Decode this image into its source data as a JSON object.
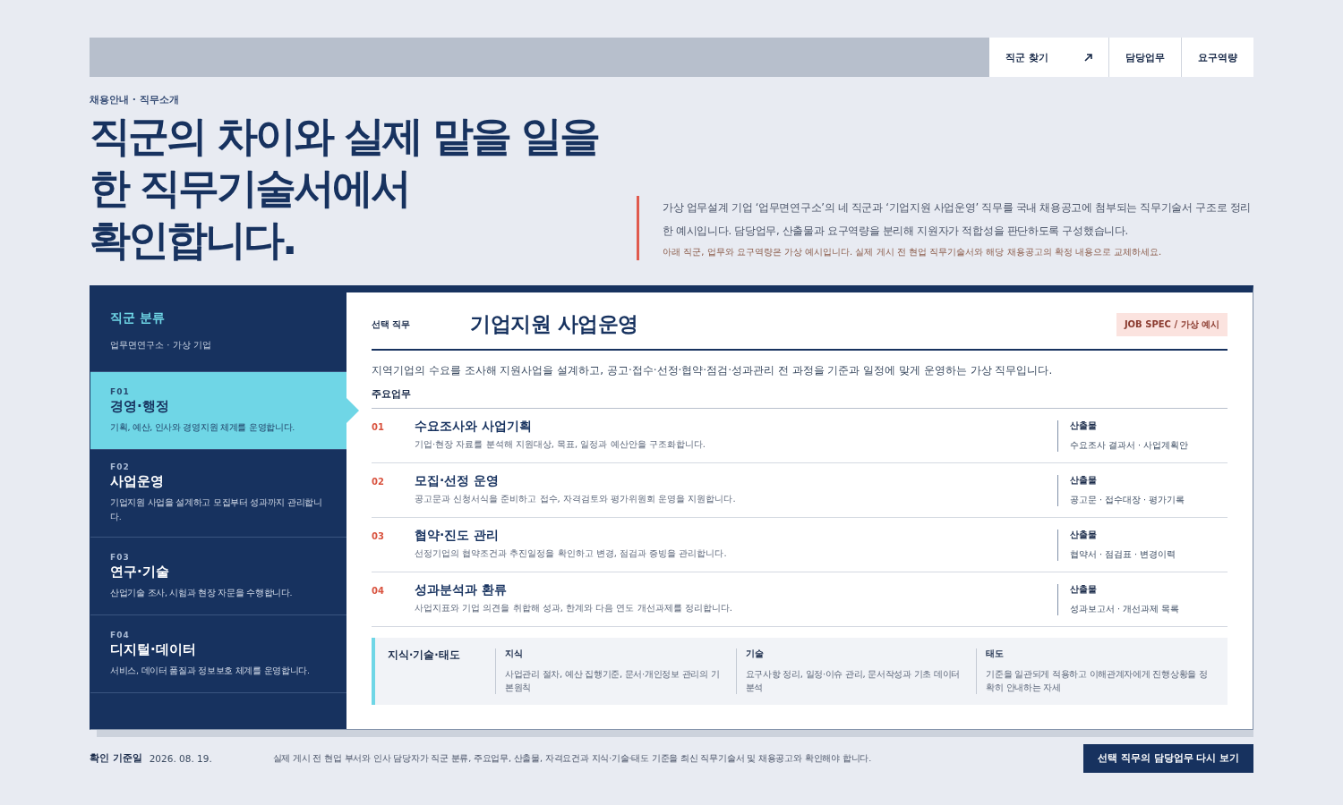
{
  "nav": [
    {
      "label": "직군 찾기",
      "kind": "external"
    },
    {
      "label": "담당업무",
      "kind": "plain"
    },
    {
      "label": "요구역량",
      "kind": "plain"
    }
  ],
  "breadcrumb": "채용안내 · 직무소개",
  "headline": [
    "직군의 차이와 실제 맡을 일을",
    "한 직무기술서에서",
    "확인합니다."
  ],
  "intro": {
    "text": "가상 업무설계 기업 ‘업무면연구소’의 네 직군과 ‘기업지원 사업운영’ 직무를 국내 채용공고에 첨부되는 직무기술서 구조로 정리한 예시입니다. 담당업무, 산출물과 요구역량을 분리해 지원자가 적합성을 판단하도록 구성했습니다.",
    "note": "아래 직군, 업무와 요구역량은 가상 예시입니다. 실제 게시 전 현업 직무기술서와 해당 채용공고의 확정 내용으로 교체하세요."
  },
  "sidebar": {
    "title": "직군 분류",
    "subtitle": "업무면연구소 · 가상 기업",
    "items": [
      {
        "code": "F01",
        "name": "경영·행정",
        "desc": "기획, 예산, 인사와 경영지원 체계를 운영합니다.",
        "selected": true
      },
      {
        "code": "F02",
        "name": "사업운영",
        "desc": "기업지원 사업을 설계하고 모집부터 성과까지 관리합니다.",
        "selected": false
      },
      {
        "code": "F03",
        "name": "연구·기술",
        "desc": "산업기술 조사, 시험과 현장 자문을 수행합니다.",
        "selected": false
      },
      {
        "code": "F04",
        "name": "디지털·데이터",
        "desc": "서비스, 데이터 품질과 정보보호 체계를 운영합니다.",
        "selected": false
      }
    ]
  },
  "job": {
    "label": "선택 직무",
    "title": "기업지원 사업운영",
    "badge": "JOB SPEC / 가상 예시",
    "summary": "지역기업의 수요를 조사해 지원사업을 설계하고, 공고·접수·선정·협약·점검·성과관리 전 과정을 기준과 일정에 맞게 운영하는 가상 직무입니다.",
    "duties_heading": "주요업무",
    "duties": [
      {
        "no": "01",
        "title": "수요조사와 사업기획",
        "desc": "기업·현장 자료를 분석해 지원대상, 목표, 일정과 예산안을 구조화합니다.",
        "output_label": "산출물",
        "output": "수요조사 결과서 · 사업계획안"
      },
      {
        "no": "02",
        "title": "모집·선정 운영",
        "desc": "공고문과 신청서식을 준비하고 접수, 자격검토와 평가위원회 운영을 지원합니다.",
        "output_label": "산출물",
        "output": "공고문 · 접수대장 · 평가기록"
      },
      {
        "no": "03",
        "title": "협약·진도 관리",
        "desc": "선정기업의 협약조건과 추진일정을 확인하고 변경, 점검과 증빙을 관리합니다.",
        "output_label": "산출물",
        "output": "협약서 · 점검표 · 변경이력"
      },
      {
        "no": "04",
        "title": "성과분석과 환류",
        "desc": "사업지표와 기업 의견을 취합해 성과, 한계와 다음 연도 개선과제를 정리합니다.",
        "output_label": "산출물",
        "output": "성과보고서 · 개선과제 목록"
      }
    ],
    "ksa": {
      "title": "지식·기술·태도",
      "items": [
        {
          "label": "지식",
          "text": "사업관리 절차, 예산 집행기준, 문서·개인정보 관리의 기본원칙"
        },
        {
          "label": "기술",
          "text": "요구사항 정리, 일정·이슈 관리, 문서작성과 기초 데이터 분석"
        },
        {
          "label": "태도",
          "text": "기준을 일관되게 적용하고 이해관계자에게 진행상황을 정확히 안내하는 자세"
        }
      ]
    }
  },
  "footer": {
    "date_label": "확인 기준일",
    "date": "2026. 08. 19.",
    "note": "실제 게시 전 현업 부서와 인사 담당자가 직군 분류, 주요업무, 산출물, 자격요건과 지식·기술·태도 기준을 최신 직무기술서 및 채용공고와 확인해야 합니다.",
    "button": "선택 직무의 담당업무 다시 보기"
  }
}
